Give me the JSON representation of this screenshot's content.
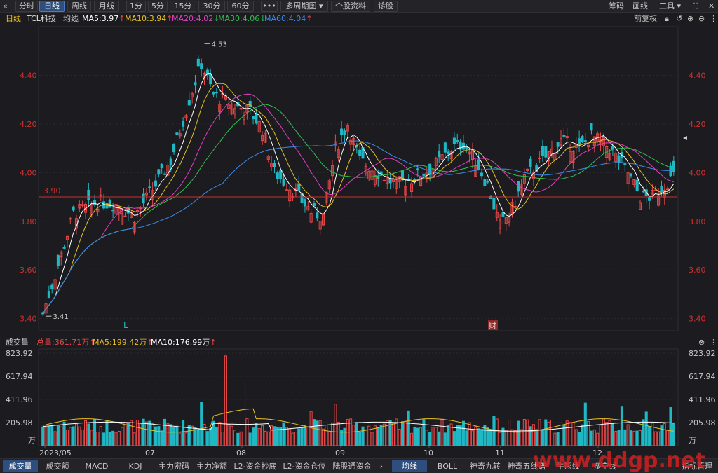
{
  "toolbar": {
    "back_icon": "double-chevron-left-icon",
    "period_tabs": [
      "分时",
      "日线",
      "周线",
      "月线",
      "1分",
      "5分",
      "15分",
      "30分",
      "60分",
      "•••",
      "多周期图 ▾",
      "个股资料",
      "诊股"
    ],
    "active_tab": "日线",
    "right_items": [
      "筹码",
      "画线",
      "工具 ▾"
    ],
    "icons": [
      "fullscreen-icon",
      "close-icon"
    ]
  },
  "legend": {
    "period": "日线",
    "stock_name": "TCL科技",
    "avg_line": "均线",
    "ma5": "MA5:3.97",
    "ma10": "MA10:3.94",
    "ma20": "MA20:4.02",
    "ma30": "MA30:4.06",
    "ma60": "MA60:4.04",
    "ma_arrows": [
      "up",
      "up",
      "down",
      "down",
      "up"
    ],
    "right_label": "前复权",
    "right_icons": [
      "lock-icon",
      "undo-icon",
      "zoom-in-icon",
      "zoom-out-icon",
      "more-icon"
    ]
  },
  "colors": {
    "up": "#e84848",
    "down": "#1fb8c4",
    "ma5": "#ffffff",
    "ma10": "#e8c020",
    "ma20": "#e040c0",
    "ma30": "#30c050",
    "ma60": "#3a8ae8",
    "axis_text": "#d03030",
    "hline": "#c83030",
    "grid": "#2a2a30"
  },
  "price_axis": {
    "ticks": [
      "4.40",
      "4.20",
      "4.00",
      "3.80",
      "3.60",
      "3.40"
    ],
    "hline_label": "3.90",
    "high_annotation": "4.53",
    "low_annotation": "3.41",
    "markers": [
      "L",
      "财"
    ]
  },
  "volume_legend": {
    "title": "成交量",
    "total": "总量:361.71万",
    "ma5": "MA5:199.42万",
    "ma10": "MA10:176.99万"
  },
  "volume_axis": {
    "ticks": [
      "823.92",
      "617.94",
      "411.96",
      "205.98"
    ],
    "unit": "万"
  },
  "x_axis": {
    "labels": [
      "2023/05",
      "07",
      "08",
      "09",
      "10",
      "11",
      "12"
    ]
  },
  "bottom_tabs": {
    "left": [
      "成交量",
      "成交额",
      "MACD",
      "KDJ",
      "主力密码",
      "主力净额",
      "L2-资金抄底",
      "L2-资金仓位",
      "陆股通资金"
    ],
    "arrow_icon": "chevron-right-icon",
    "right": [
      "均线",
      "BOLL",
      "神奇九转",
      "神奇五线谱",
      "牛熊线",
      "多空线"
    ],
    "settings": "指标管理",
    "active_left": "成交量",
    "active_right": "均线"
  },
  "watermark": "www.ddgp.net",
  "chart_data": {
    "type": "candlestick",
    "price_range": [
      3.35,
      4.6
    ],
    "volume_range": [
      0,
      823.92
    ],
    "x_labels": [
      "2023/05",
      "07",
      "08",
      "09",
      "10",
      "11",
      "12"
    ],
    "y_ticks": [
      4.4,
      4.2,
      4.0,
      3.8,
      3.6,
      3.4
    ],
    "reference_line": 3.9,
    "period_high": 4.53,
    "period_low": 3.41,
    "last_ma": {
      "MA5": 3.97,
      "MA10": 3.94,
      "MA20": 4.02,
      "MA30": 4.06,
      "MA60": 4.04
    },
    "volume": {
      "total": 361.71,
      "MA5": 199.42,
      "MA10": 176.99,
      "unit": "万"
    }
  }
}
